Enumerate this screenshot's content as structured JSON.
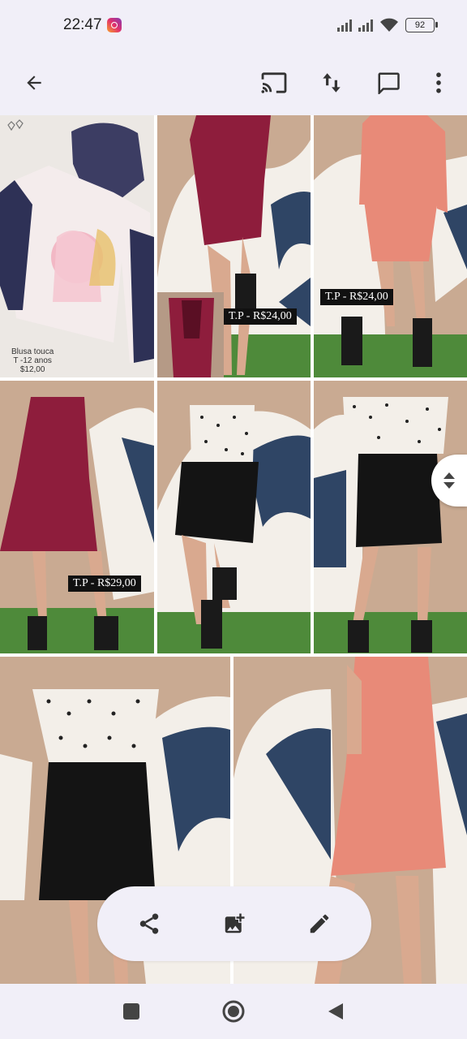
{
  "status_bar": {
    "time": "22:47",
    "battery": "92",
    "notification_icon": "instagram-icon"
  },
  "app_bar": {
    "icons": [
      "back-arrow-icon",
      "cast-icon",
      "sort-icon",
      "comment-icon",
      "more-vert-icon"
    ]
  },
  "grid": {
    "photos": [
      {
        "name": "photo-hoodie-shirt",
        "caption_lines": [
          "Blusa touca",
          "T -12 anos",
          "$12,00"
        ]
      },
      {
        "name": "photo-burgundy-dress",
        "price": "T.P - R$24,00"
      },
      {
        "name": "photo-salmon-dress",
        "price": "T.P - R$24,00"
      },
      {
        "name": "photo-wine-dress",
        "price": "T.P - R$29,00"
      },
      {
        "name": "photo-polka-dot-dress-1"
      },
      {
        "name": "photo-polka-dot-dress-2"
      },
      {
        "name": "photo-polka-dot-dress-3"
      },
      {
        "name": "photo-salmon-dress-back"
      }
    ]
  },
  "actions": {
    "icons": [
      "share-icon",
      "add-photo-icon",
      "edit-icon"
    ]
  },
  "nav_bar": {
    "icons": [
      "recents-icon",
      "home-icon",
      "back-icon"
    ]
  },
  "colors": {
    "bar_background": "#f1eff8",
    "burgundy": "#8e1d3c",
    "salmon": "#e88a78",
    "grass": "#4e8a3a",
    "wall": "#c9aa92"
  }
}
